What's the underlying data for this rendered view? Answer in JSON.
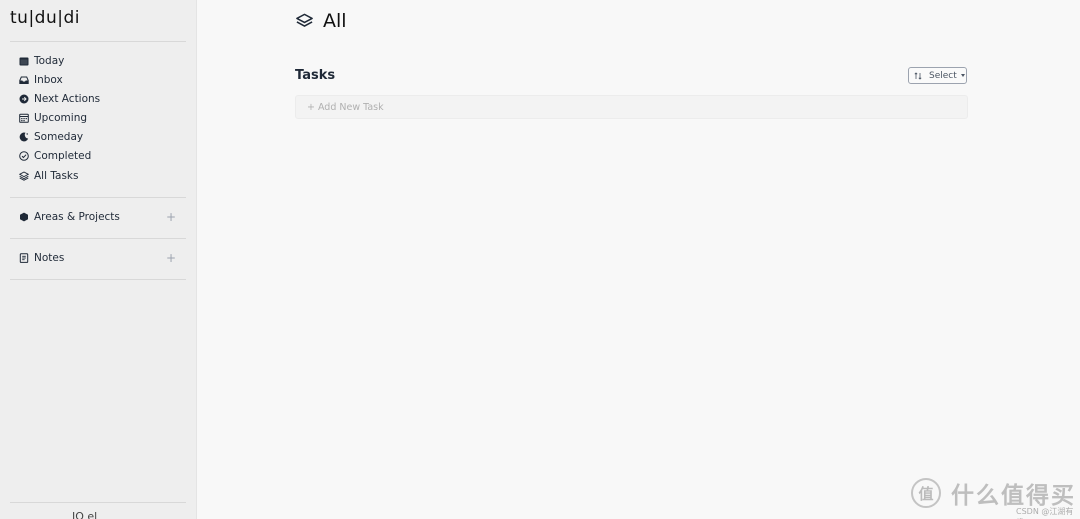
{
  "app": {
    "brand": "tu|du|di"
  },
  "sidebar": {
    "nav": [
      {
        "label": "Today",
        "icon": "calendar-icon"
      },
      {
        "label": "Inbox",
        "icon": "inbox-icon"
      },
      {
        "label": "Next Actions",
        "icon": "arrow-right-circle-icon"
      },
      {
        "label": "Upcoming",
        "icon": "calendar-days-icon"
      },
      {
        "label": "Someday",
        "icon": "moon-icon"
      },
      {
        "label": "Completed",
        "icon": "check-circle-icon"
      },
      {
        "label": "All Tasks",
        "icon": "layers-icon"
      }
    ],
    "areas_projects": {
      "label": "Areas & Projects",
      "icon": "hexagon-icon"
    },
    "notes": {
      "label": "Notes",
      "icon": "notebook-icon"
    },
    "add_symbol": "+",
    "footer_text": "JO   el"
  },
  "main": {
    "title": "All",
    "title_icon": "layers-icon",
    "section_title": "Tasks",
    "select_button": {
      "label": "Select",
      "icon": "sort-icon"
    },
    "add_task_placeholder": "+ Add New Task"
  },
  "watermark": {
    "logo_char": "值",
    "text": "什么值得买",
    "sub": "CSDN @江湖有缘"
  }
}
